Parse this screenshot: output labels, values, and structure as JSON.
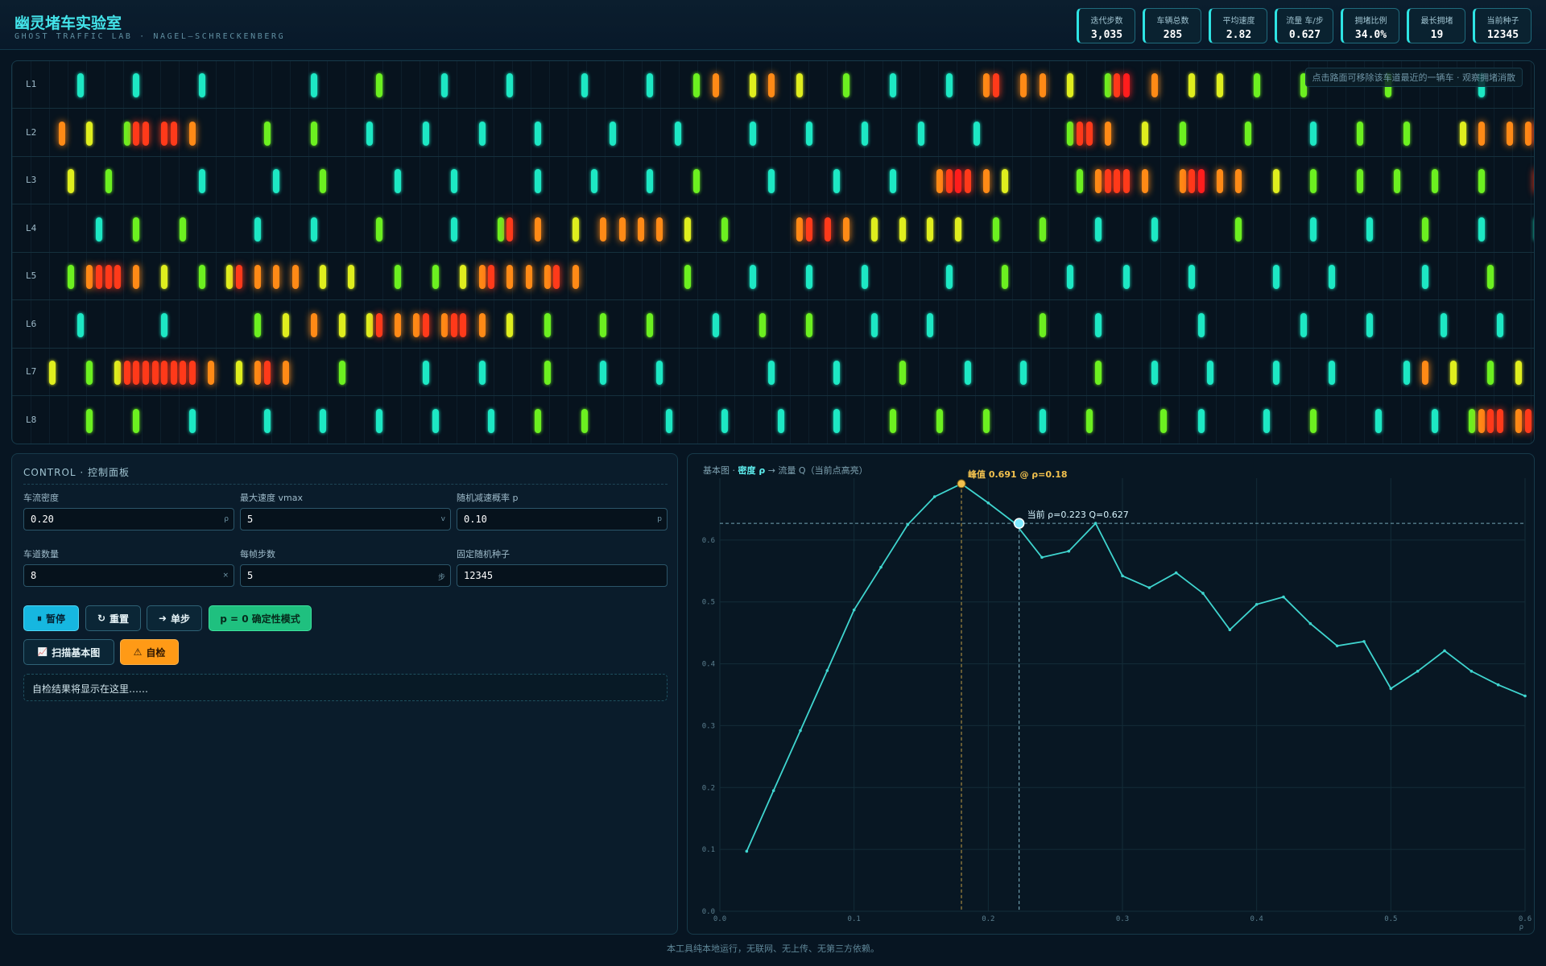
{
  "header": {
    "title": "幽灵堵车实验室",
    "subtitle": "GHOST TRAFFIC LAB · NAGEL–SCHRECKENBERG",
    "stats": [
      {
        "label": "迭代步数",
        "value": "3,035"
      },
      {
        "label": "车辆总数",
        "value": "285"
      },
      {
        "label": "平均速度",
        "value": "2.82"
      },
      {
        "label": "流量 车/步",
        "value": "0.627"
      },
      {
        "label": "拥堵比例",
        "value": "34.0%"
      },
      {
        "label": "最长拥堵",
        "value": "19"
      },
      {
        "label": "当前种子",
        "value": "12345"
      }
    ]
  },
  "road": {
    "hint": "点击路面可移除该车道最近的一辆车 · 观察拥堵消散",
    "speed_colors": [
      "#ff1d1d",
      "#ff3a1a",
      "#ff8a16",
      "#dfee1e",
      "#6cf020",
      "#1de8c4"
    ],
    "lanes": [
      {
        "label": "L1",
        "cars": [
          [
            3,
            5
          ],
          [
            9,
            5
          ],
          [
            16,
            5
          ],
          [
            28,
            5
          ],
          [
            35,
            4
          ],
          [
            42,
            5
          ],
          [
            49,
            5
          ],
          [
            57,
            5
          ],
          [
            64,
            5
          ],
          [
            69,
            4
          ],
          [
            71,
            2
          ],
          [
            75,
            3
          ],
          [
            77,
            2
          ],
          [
            80,
            3
          ],
          [
            85,
            4
          ],
          [
            90,
            5
          ],
          [
            96,
            5
          ],
          [
            100,
            2
          ],
          [
            101,
            1
          ],
          [
            104,
            2
          ],
          [
            106,
            2
          ],
          [
            109,
            3
          ],
          [
            113,
            4
          ],
          [
            114,
            1
          ],
          [
            115,
            0
          ],
          [
            118,
            2
          ],
          [
            122,
            3
          ],
          [
            125,
            3
          ],
          [
            129,
            4
          ],
          [
            134,
            4
          ],
          [
            143,
            4
          ],
          [
            153,
            5
          ],
          [
            161,
            5
          ],
          [
            168,
            5
          ]
        ]
      },
      {
        "label": "L2",
        "cars": [
          [
            1,
            2
          ],
          [
            4,
            3
          ],
          [
            8,
            4
          ],
          [
            9,
            1
          ],
          [
            10,
            1
          ],
          [
            12,
            1
          ],
          [
            13,
            1
          ],
          [
            15,
            2
          ],
          [
            23,
            4
          ],
          [
            28,
            4
          ],
          [
            34,
            5
          ],
          [
            40,
            5
          ],
          [
            46,
            5
          ],
          [
            52,
            5
          ],
          [
            60,
            5
          ],
          [
            67,
            5
          ],
          [
            75,
            5
          ],
          [
            81,
            5
          ],
          [
            87,
            5
          ],
          [
            93,
            5
          ],
          [
            99,
            5
          ],
          [
            109,
            4
          ],
          [
            110,
            1
          ],
          [
            111,
            1
          ],
          [
            113,
            2
          ],
          [
            117,
            3
          ],
          [
            121,
            4
          ],
          [
            128,
            4
          ],
          [
            135,
            5
          ],
          [
            140,
            4
          ],
          [
            145,
            4
          ],
          [
            151,
            3
          ],
          [
            153,
            2
          ],
          [
            156,
            2
          ],
          [
            158,
            2
          ],
          [
            159,
            1
          ],
          [
            160,
            0
          ],
          [
            161,
            0
          ]
        ]
      },
      {
        "label": "L3",
        "cars": [
          [
            2,
            3
          ],
          [
            6,
            4
          ],
          [
            16,
            5
          ],
          [
            24,
            5
          ],
          [
            29,
            4
          ],
          [
            37,
            5
          ],
          [
            43,
            5
          ],
          [
            52,
            5
          ],
          [
            58,
            5
          ],
          [
            64,
            5
          ],
          [
            69,
            4
          ],
          [
            77,
            5
          ],
          [
            84,
            5
          ],
          [
            90,
            5
          ],
          [
            95,
            2
          ],
          [
            96,
            1
          ],
          [
            97,
            0
          ],
          [
            98,
            1
          ],
          [
            100,
            2
          ],
          [
            102,
            3
          ],
          [
            110,
            4
          ],
          [
            112,
            2
          ],
          [
            113,
            1
          ],
          [
            114,
            1
          ],
          [
            115,
            1
          ],
          [
            117,
            2
          ],
          [
            121,
            2
          ],
          [
            122,
            1
          ],
          [
            123,
            0
          ],
          [
            125,
            2
          ],
          [
            127,
            2
          ],
          [
            131,
            3
          ],
          [
            135,
            4
          ],
          [
            140,
            4
          ],
          [
            144,
            4
          ],
          [
            148,
            4
          ],
          [
            153,
            4
          ],
          [
            159,
            1
          ],
          [
            160,
            0
          ]
        ]
      },
      {
        "label": "L4",
        "cars": [
          [
            5,
            5
          ],
          [
            9,
            4
          ],
          [
            14,
            4
          ],
          [
            22,
            5
          ],
          [
            28,
            5
          ],
          [
            35,
            4
          ],
          [
            43,
            5
          ],
          [
            48,
            4
          ],
          [
            49,
            1
          ],
          [
            52,
            2
          ],
          [
            56,
            3
          ],
          [
            59,
            2
          ],
          [
            61,
            2
          ],
          [
            63,
            2
          ],
          [
            65,
            2
          ],
          [
            68,
            3
          ],
          [
            72,
            4
          ],
          [
            80,
            2
          ],
          [
            81,
            1
          ],
          [
            83,
            1
          ],
          [
            85,
            2
          ],
          [
            88,
            3
          ],
          [
            91,
            3
          ],
          [
            94,
            3
          ],
          [
            97,
            3
          ],
          [
            101,
            4
          ],
          [
            106,
            4
          ],
          [
            112,
            5
          ],
          [
            118,
            5
          ],
          [
            127,
            4
          ],
          [
            135,
            5
          ],
          [
            141,
            5
          ],
          [
            147,
            4
          ],
          [
            153,
            5
          ],
          [
            159,
            5
          ]
        ]
      },
      {
        "label": "L5",
        "cars": [
          [
            2,
            4
          ],
          [
            4,
            2
          ],
          [
            5,
            1
          ],
          [
            6,
            1
          ],
          [
            7,
            1
          ],
          [
            9,
            2
          ],
          [
            12,
            3
          ],
          [
            16,
            4
          ],
          [
            19,
            3
          ],
          [
            20,
            1
          ],
          [
            22,
            2
          ],
          [
            24,
            2
          ],
          [
            26,
            2
          ],
          [
            29,
            3
          ],
          [
            32,
            3
          ],
          [
            37,
            4
          ],
          [
            41,
            4
          ],
          [
            44,
            3
          ],
          [
            46,
            2
          ],
          [
            47,
            1
          ],
          [
            49,
            2
          ],
          [
            51,
            2
          ],
          [
            53,
            2
          ],
          [
            54,
            1
          ],
          [
            56,
            2
          ],
          [
            68,
            4
          ],
          [
            75,
            5
          ],
          [
            81,
            5
          ],
          [
            87,
            5
          ],
          [
            96,
            5
          ],
          [
            102,
            4
          ],
          [
            109,
            5
          ],
          [
            115,
            5
          ],
          [
            122,
            5
          ],
          [
            131,
            5
          ],
          [
            137,
            5
          ],
          [
            147,
            5
          ],
          [
            154,
            4
          ]
        ]
      },
      {
        "label": "L6",
        "cars": [
          [
            3,
            5
          ],
          [
            12,
            5
          ],
          [
            22,
            4
          ],
          [
            25,
            3
          ],
          [
            28,
            2
          ],
          [
            31,
            3
          ],
          [
            34,
            3
          ],
          [
            35,
            1
          ],
          [
            37,
            2
          ],
          [
            39,
            2
          ],
          [
            40,
            1
          ],
          [
            42,
            2
          ],
          [
            43,
            1
          ],
          [
            44,
            1
          ],
          [
            46,
            2
          ],
          [
            49,
            3
          ],
          [
            53,
            4
          ],
          [
            59,
            4
          ],
          [
            64,
            4
          ],
          [
            71,
            5
          ],
          [
            76,
            4
          ],
          [
            81,
            4
          ],
          [
            88,
            5
          ],
          [
            94,
            5
          ],
          [
            106,
            4
          ],
          [
            112,
            5
          ],
          [
            123,
            5
          ],
          [
            134,
            5
          ],
          [
            141,
            5
          ],
          [
            149,
            5
          ],
          [
            155,
            5
          ]
        ]
      },
      {
        "label": "L7",
        "cars": [
          [
            0,
            3
          ],
          [
            4,
            4
          ],
          [
            7,
            3
          ],
          [
            8,
            1
          ],
          [
            9,
            1
          ],
          [
            10,
            1
          ],
          [
            11,
            1
          ],
          [
            12,
            1
          ],
          [
            13,
            1
          ],
          [
            14,
            1
          ],
          [
            15,
            1
          ],
          [
            17,
            2
          ],
          [
            20,
            3
          ],
          [
            22,
            2
          ],
          [
            23,
            1
          ],
          [
            25,
            2
          ],
          [
            31,
            4
          ],
          [
            40,
            5
          ],
          [
            46,
            5
          ],
          [
            53,
            4
          ],
          [
            59,
            5
          ],
          [
            65,
            5
          ],
          [
            77,
            5
          ],
          [
            84,
            5
          ],
          [
            91,
            4
          ],
          [
            98,
            5
          ],
          [
            104,
            5
          ],
          [
            112,
            4
          ],
          [
            118,
            5
          ],
          [
            124,
            5
          ],
          [
            131,
            5
          ],
          [
            137,
            5
          ],
          [
            145,
            5
          ],
          [
            147,
            2
          ],
          [
            150,
            3
          ],
          [
            154,
            4
          ],
          [
            157,
            3
          ]
        ]
      },
      {
        "label": "L8",
        "cars": [
          [
            4,
            4
          ],
          [
            9,
            4
          ],
          [
            15,
            5
          ],
          [
            23,
            5
          ],
          [
            29,
            5
          ],
          [
            35,
            5
          ],
          [
            41,
            5
          ],
          [
            47,
            5
          ],
          [
            52,
            4
          ],
          [
            57,
            4
          ],
          [
            66,
            5
          ],
          [
            72,
            5
          ],
          [
            78,
            5
          ],
          [
            84,
            5
          ],
          [
            90,
            4
          ],
          [
            95,
            4
          ],
          [
            100,
            4
          ],
          [
            106,
            5
          ],
          [
            111,
            4
          ],
          [
            119,
            4
          ],
          [
            123,
            5
          ],
          [
            130,
            5
          ],
          [
            135,
            4
          ],
          [
            142,
            5
          ],
          [
            148,
            5
          ],
          [
            152,
            4
          ],
          [
            153,
            2
          ],
          [
            154,
            1
          ],
          [
            155,
            1
          ],
          [
            157,
            2
          ],
          [
            158,
            1
          ],
          [
            160,
            2
          ],
          [
            162,
            2
          ],
          [
            164,
            2
          ]
        ]
      }
    ]
  },
  "control": {
    "title": "CONTROL · 控制面板",
    "fields": [
      {
        "label": "车流密度",
        "value": "0.20",
        "unit": "ρ"
      },
      {
        "label": "最大速度 vmax",
        "value": "5",
        "unit": "v"
      },
      {
        "label": "随机减速概率 p",
        "value": "0.10",
        "unit": "p"
      },
      {
        "label": "车道数量",
        "value": "8",
        "unit": "×"
      },
      {
        "label": "每帧步数",
        "value": "5",
        "unit": "步"
      },
      {
        "label": "固定随机种子",
        "value": "12345",
        "unit": ""
      }
    ],
    "buttons": {
      "pause": "暂停",
      "reset": "重置",
      "step": "单步",
      "deterministic": "p = 0 确定性模式",
      "sweep": "扫描基本图",
      "selftest": "自检"
    },
    "icons": {
      "pause": "⏸",
      "reset": "↻",
      "step": "➜",
      "sweep": "📈",
      "selftest": "⚠"
    },
    "result_text": "自检结果将显示在这里……"
  },
  "chart": {
    "title_prefix": "基本图 · ",
    "title_density": "密度 ρ",
    "title_rest": " → 流量 Q（当前点高亮）",
    "peak_label": "峰值 0.691 @ ρ=0.18",
    "current_label": "当前 ρ=0.223  Q=0.627",
    "x_axis_unit": "ρ"
  },
  "chart_data": {
    "type": "line",
    "xlabel": "ρ",
    "ylabel": "",
    "xlim": [
      0,
      0.6
    ],
    "ylim": [
      0,
      0.7
    ],
    "x_ticks": [
      "0.0",
      "0.1",
      "0.2",
      "0.3",
      "0.4",
      "0.5",
      "0.6"
    ],
    "y_ticks": [
      "0.0",
      "0.1",
      "0.2",
      "0.3",
      "0.4",
      "0.5",
      "0.6"
    ],
    "x": [
      0.02,
      0.04,
      0.06,
      0.08,
      0.1,
      0.12,
      0.14,
      0.16,
      0.18,
      0.2,
      0.22,
      0.24,
      0.26,
      0.28,
      0.3,
      0.32,
      0.34,
      0.36,
      0.38,
      0.4,
      0.42,
      0.44,
      0.46,
      0.48,
      0.5,
      0.52,
      0.54,
      0.56,
      0.58,
      0.6
    ],
    "y": [
      0.097,
      0.195,
      0.292,
      0.389,
      0.487,
      0.556,
      0.625,
      0.67,
      0.691,
      0.66,
      0.627,
      0.572,
      0.582,
      0.627,
      0.542,
      0.523,
      0.547,
      0.514,
      0.455,
      0.496,
      0.508,
      0.465,
      0.429,
      0.436,
      0.36,
      0.388,
      0.421,
      0.388,
      0.366,
      0.348
    ],
    "peak": {
      "x": 0.18,
      "y": 0.691
    },
    "current": {
      "x": 0.223,
      "y": 0.627
    },
    "grid": true,
    "line_color": "#3fd5cf",
    "peak_color": "#f2c14e",
    "current_color": "#7fe9ff"
  },
  "footer": "本工具纯本地运行，无联网、无上传、无第三方依赖。"
}
